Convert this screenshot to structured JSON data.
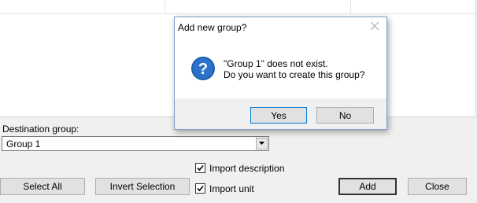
{
  "form": {
    "destination_label": "Destination group:",
    "destination_value": "Group 1",
    "import_description_label": "Import description",
    "import_description_checked": true,
    "import_unit_label": "Import unit",
    "import_unit_checked": true,
    "select_all_label": "Select All",
    "invert_selection_label": "Invert Selection",
    "add_label": "Add",
    "close_label": "Close"
  },
  "dialog": {
    "title": "Add new group?",
    "message_line1": "\"Group 1\" does not exist.",
    "message_line2": "Do you want to create this group?",
    "yes_label": "Yes",
    "no_label": "No",
    "icon": "question-icon"
  },
  "colors": {
    "accent_blue": "#0078d7",
    "dialog_border": "#7d9fc6",
    "question_icon": "#1c5fae"
  }
}
